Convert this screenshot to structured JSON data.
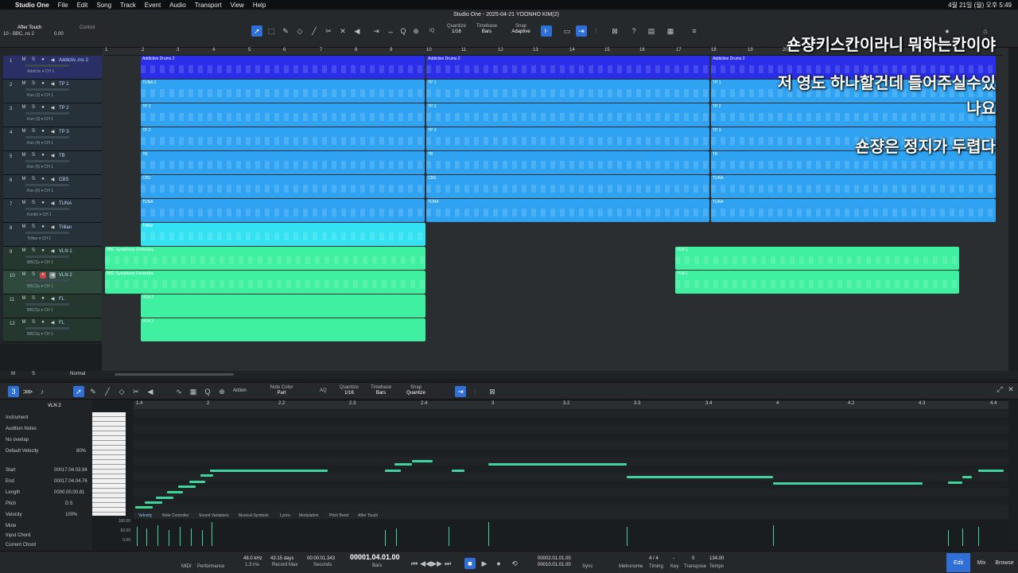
{
  "mac_menu": {
    "apple": "",
    "app": "Studio One",
    "items": [
      "File",
      "Edit",
      "Song",
      "Track",
      "Event",
      "Audio",
      "Transport",
      "View",
      "Help"
    ],
    "status": "4월 21일 (월) 오후 5:49"
  },
  "window": {
    "title": "Studio One - 2025-04-21 YOONHO KIM(2)"
  },
  "toolbar": {
    "after_touch": "After Touch",
    "control": "Control",
    "track_label": "10 - BBC..ns 2",
    "value": "0.00",
    "quantize_label": "Quantize",
    "quantize_value": "1/16",
    "timebase_label": "Timebase",
    "timebase_value": "Bars",
    "snap_label": "Snap",
    "snap_value": "Adaptive",
    "iq": "IQ"
  },
  "ruler_marks": [
    "1",
    "2",
    "3",
    "4",
    "5",
    "6",
    "7",
    "8",
    "9",
    "10",
    "11",
    "12",
    "13",
    "14",
    "15",
    "16",
    "17",
    "18",
    "19",
    "20"
  ],
  "tracks": [
    {
      "num": "1",
      "name": "Addictiv..ms 2",
      "sub": "Addictiv ▾  CH 1"
    },
    {
      "num": "2",
      "name": "TP 1",
      "sub": "Kon (2) ▾  CH 1"
    },
    {
      "num": "3",
      "name": "TP 2",
      "sub": "Kon (3) ▾  CH 1"
    },
    {
      "num": "4",
      "name": "TP 3",
      "sub": "Kon (4) ▾  CH 1"
    },
    {
      "num": "5",
      "name": "TB",
      "sub": "Kon (5) ▾  CH 1"
    },
    {
      "num": "6",
      "name": "CBS",
      "sub": "Kon (6) ▾  CH 1"
    },
    {
      "num": "7",
      "name": "TUNA",
      "sub": "Kontkt ▾  CH 1"
    },
    {
      "num": "8",
      "name": "Trilian",
      "sub": "Trilian ▾  CH 1"
    },
    {
      "num": "9",
      "name": "VLN 1",
      "sub": "BBCSy ▾  CH 1"
    },
    {
      "num": "10",
      "name": "VLN 2",
      "sub": "BBCSy ▾  CH 1"
    },
    {
      "num": "11",
      "name": "FL",
      "sub": "BBCSy ▾  CH 1"
    },
    {
      "num": "12",
      "name": "FL",
      "sub": "BBCSy ▾  CH 1"
    }
  ],
  "clips": {
    "drums": "Addictive Drums 2",
    "tuna2": "TUNA 2",
    "tp1": "TP 1",
    "tp2": "TP 2",
    "tp3": "TP 3",
    "tb": "TB",
    "cbs": "CBS",
    "tuna": "TUNA",
    "trilian": "Trilian",
    "bbc": "BBC Symphony Orchestra",
    "vln1": "VLN 1",
    "vln3": "VLN 3"
  },
  "subtitles": [
    "숀쟝키스칸이라니 뭐하는칸이야",
    "저 영도 하나할건데 들어주실수있",
    "나요",
    "숀쟝은 정지가 두렵다"
  ],
  "arrange_footer": {
    "m": "M",
    "s": "S",
    "mode": "Normal"
  },
  "editor": {
    "track": "VLN 2",
    "action": "Action",
    "note_color_label": "Note Color",
    "note_color_value": "Part",
    "aq": "AQ",
    "quantize_label": "Quantize",
    "quantize_value": "1/16",
    "timebase_label": "Timebase",
    "timebase_value": "Bars",
    "snap_label": "Snap",
    "snap_value": "Quantize"
  },
  "editor_ruler": [
    "1.4",
    "2",
    "2.2",
    "2.3",
    "2.4",
    "3",
    "3.2",
    "3.3",
    "3.4",
    "4",
    "4.2",
    "4.3",
    "4.4"
  ],
  "inspector": {
    "instrument": "Instrument",
    "audition": "Audition Notes",
    "overlap": "No overlap",
    "default_velocity_label": "Default Velocity",
    "default_velocity": "80%",
    "start_label": "Start",
    "start": "00017.04.03.94",
    "end_label": "End",
    "end": "00017.04.04.76",
    "length_label": "Length",
    "length": "0000.00.00.81",
    "pitch_label": "Pitch",
    "pitch": "D 5",
    "velocity_label": "Velocity",
    "velocity": "100%",
    "mute": "Mute",
    "input_chord": "Input Chord",
    "current_chord": "Current Chord"
  },
  "vel_tabs": [
    "Velocity",
    "Note Controller",
    "Sound Variations",
    "Musical Symbols",
    "Lyrics",
    "Modulation",
    "Pitch Bend",
    "After Touch"
  ],
  "vel_scale": [
    "100.00",
    "50.00",
    "0.00"
  ],
  "transport": {
    "midi": "MIDI",
    "performance": "Performance",
    "sample_rate": "48.0 kHz",
    "buffer": "1.3 ms",
    "record_max": "43:15 days",
    "record_max_label": "Record Max",
    "seconds": "00:00:01.343",
    "seconds_label": "Seconds",
    "bars": "00001.04.01.00",
    "bars_label": "Bars",
    "loop_l": "00002.01.01.00",
    "loop_r": "00010.01.01.00",
    "sync": "Sync",
    "metronome": "Metronome",
    "timing": "4 / 4",
    "timing_label": "Timing",
    "key": "-",
    "key_label": "Key",
    "transpose": "0",
    "transpose_label": "Transpose",
    "tempo": "134.00",
    "tempo_label": "Tempo",
    "edit": "Edit",
    "mix": "Mix",
    "browse": "Browse"
  }
}
